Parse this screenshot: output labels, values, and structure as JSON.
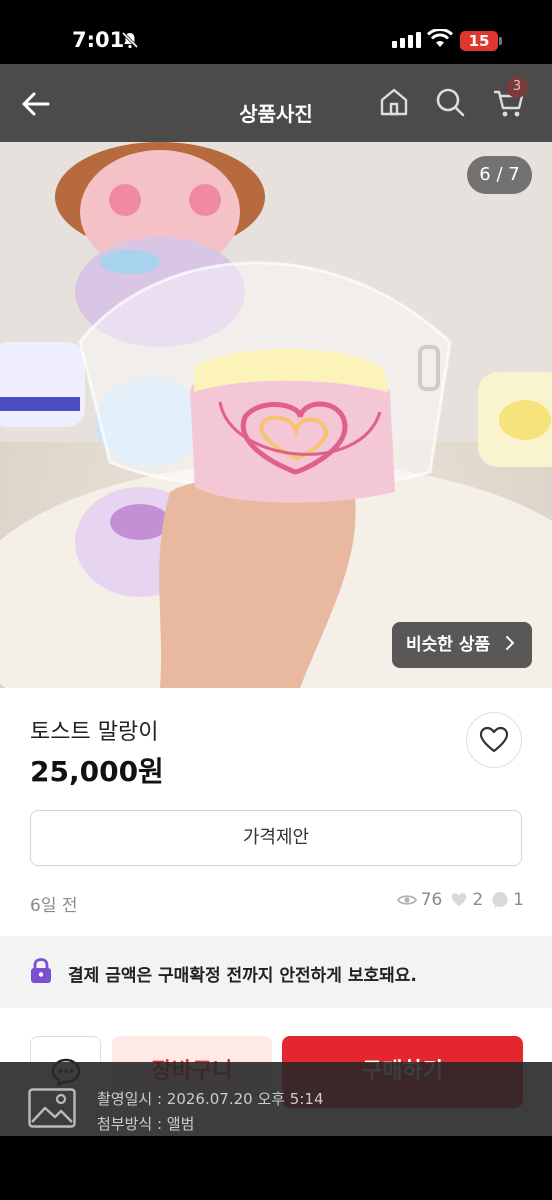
{
  "status_bar": {
    "time": "7:01",
    "battery": "15"
  },
  "header": {
    "title": "상품사진",
    "cart_count": "3"
  },
  "photo": {
    "counter": "6 / 7",
    "similar_label": "비슷한 상품"
  },
  "product": {
    "title": "토스트 말랑이",
    "price": "25,000원",
    "offer_label": "가격제안",
    "posted": "6일 전",
    "views": "76",
    "likes": "2",
    "chats": "1"
  },
  "notice": {
    "text": "결제 금액은 구매확정 전까지 안전하게 보호돼요."
  },
  "actions": {
    "cart_label": "장바구니",
    "buy_label": "구매하기"
  },
  "capture_info": {
    "date_line": "촬영일시 : 2026.07.20 오후 5:14",
    "method_line": "첨부방식 : 앨범"
  },
  "colors": {
    "accent": "#e4262e",
    "cart_bg": "#ffe9e7",
    "nav_bg": "#4b4b4b"
  },
  "icons": [
    "bell-off-icon",
    "signal-icon",
    "wifi-icon",
    "back-arrow-icon",
    "home-icon",
    "search-icon",
    "cart-icon",
    "heart-icon",
    "eye-icon",
    "lock-icon",
    "chat-icon",
    "image-icon",
    "chevron-right-icon"
  ]
}
